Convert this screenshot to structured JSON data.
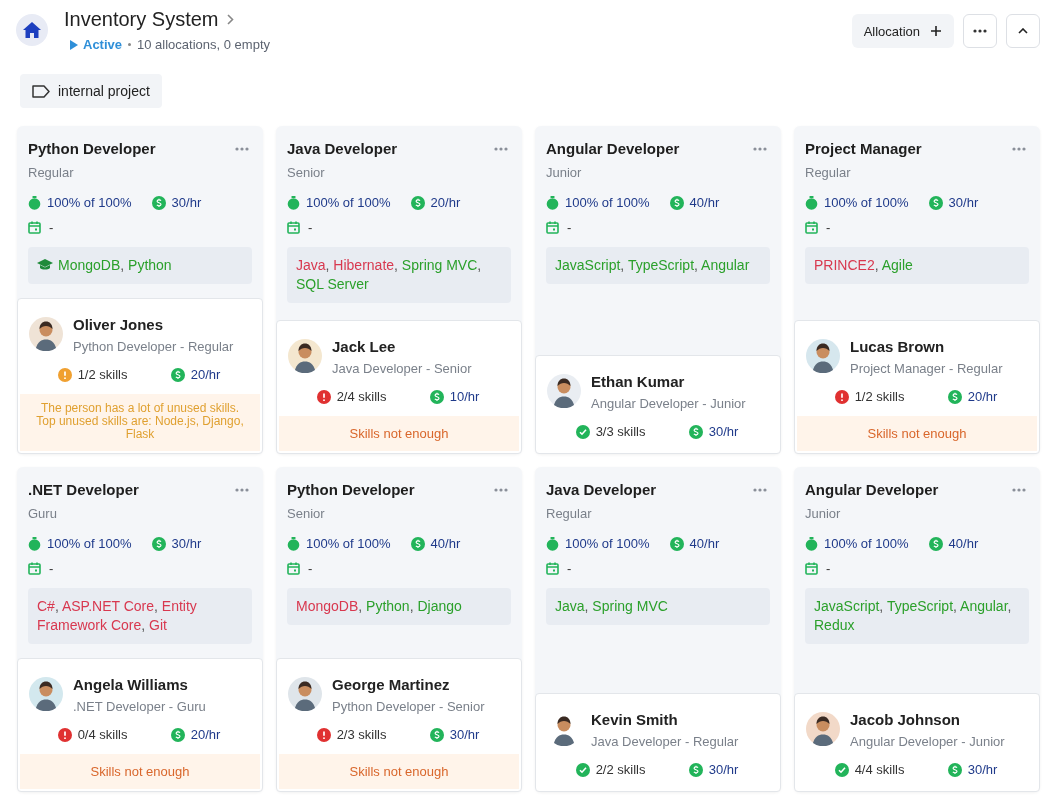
{
  "header": {
    "title": "Inventory System",
    "status": "Active",
    "summary": "10 allocations, 0 empty",
    "buttons": [
      {
        "kind": "add",
        "label": "Allocation"
      },
      {
        "kind": "more"
      },
      {
        "kind": "collapse"
      }
    ]
  },
  "tags": [
    {
      "label": "internal project"
    }
  ],
  "cards": [
    {
      "role": "Python Developer",
      "level": "Regular",
      "allocation": "100% of 100%",
      "rate": "30/hr",
      "date": "-",
      "skills_icon": true,
      "skills": [
        {
          "name": "MongoDB",
          "matched": true,
          "separator": ","
        },
        {
          "name": "Python",
          "matched": true
        }
      ],
      "person": {
        "name": "Oliver Jones",
        "subtitle": "Python Developer - Regular",
        "kind": "partial",
        "skills_count": "1/2 skills",
        "rate": "20/hr",
        "warning": {
          "kind": "unused",
          "text": "The person has a lot of unused skills. Top unused skills are: Node.js, Django, Flask"
        }
      }
    },
    {
      "role": "Java Developer",
      "level": "Senior",
      "allocation": "100% of 100%",
      "rate": "20/hr",
      "date": "-",
      "skills_icon": false,
      "skills": [
        {
          "name": "Java",
          "matched": false,
          "separator": ","
        },
        {
          "name": "Hibernate",
          "matched": false,
          "separator": ","
        },
        {
          "name": "Spring MVC",
          "matched": true,
          "separator": ","
        },
        {
          "name": "SQL Server",
          "matched": true
        }
      ],
      "person": {
        "name": "Jack Lee",
        "subtitle": "Java Developer - Senior",
        "kind": "missing",
        "skills_count": "2/4 skills",
        "rate": "10/hr",
        "warning": {
          "kind": "insufficient",
          "text": "Skills not enough"
        }
      }
    },
    {
      "role": "Angular Developer",
      "level": "Junior",
      "allocation": "100% of 100%",
      "rate": "40/hr",
      "date": "-",
      "skills_icon": false,
      "skills": [
        {
          "name": "JavaScript",
          "matched": true,
          "separator": ","
        },
        {
          "name": "TypeScript",
          "matched": true,
          "separator": ","
        },
        {
          "name": "Angular",
          "matched": true
        }
      ],
      "person": {
        "name": "Ethan Kumar",
        "subtitle": "Angular Developer - Junior",
        "kind": "complete",
        "skills_count": "3/3 skills",
        "rate": "30/hr"
      }
    },
    {
      "role": "Project Manager",
      "level": "Regular",
      "allocation": "100% of 100%",
      "rate": "30/hr",
      "date": "-",
      "skills_icon": false,
      "skills": [
        {
          "name": "PRINCE2",
          "matched": false,
          "separator": ","
        },
        {
          "name": "Agile",
          "matched": true
        }
      ],
      "person": {
        "name": "Lucas Brown",
        "subtitle": "Project Manager - Regular",
        "kind": "missing",
        "skills_count": "1/2 skills",
        "rate": "20/hr",
        "warning": {
          "kind": "insufficient",
          "text": "Skills not enough"
        }
      }
    },
    {
      "role": ".NET Developer",
      "level": "Guru",
      "allocation": "100% of 100%",
      "rate": "30/hr",
      "date": "-",
      "skills_icon": false,
      "skills": [
        {
          "name": "C#",
          "matched": false,
          "separator": ","
        },
        {
          "name": "ASP.NET Core",
          "matched": false,
          "separator": ","
        },
        {
          "name": "Entity Framework Core",
          "matched": false,
          "separator": ","
        },
        {
          "name": "Git",
          "matched": false
        }
      ],
      "person": {
        "name": "Angela Williams",
        "subtitle": ".NET Developer - Guru",
        "kind": "missing",
        "skills_count": "0/4 skills",
        "rate": "20/hr",
        "warning": {
          "kind": "insufficient",
          "text": "Skills not enough"
        }
      }
    },
    {
      "role": "Python Developer",
      "level": "Senior",
      "allocation": "100% of 100%",
      "rate": "40/hr",
      "date": "-",
      "skills_icon": false,
      "skills": [
        {
          "name": "MongoDB",
          "matched": false,
          "separator": ","
        },
        {
          "name": "Python",
          "matched": true,
          "separator": ","
        },
        {
          "name": "Django",
          "matched": true
        }
      ],
      "person": {
        "name": "George Martinez",
        "subtitle": "Python Developer - Senior",
        "kind": "missing",
        "skills_count": "2/3 skills",
        "rate": "30/hr",
        "warning": {
          "kind": "insufficient",
          "text": "Skills not enough"
        }
      }
    },
    {
      "role": "Java Developer",
      "level": "Regular",
      "allocation": "100% of 100%",
      "rate": "40/hr",
      "date": "-",
      "skills_icon": false,
      "skills": [
        {
          "name": "Java",
          "matched": true,
          "separator": ","
        },
        {
          "name": "Spring MVC",
          "matched": true
        }
      ],
      "person": {
        "name": "Kevin Smith",
        "subtitle": "Java Developer - Regular",
        "kind": "complete",
        "skills_count": "2/2 skills",
        "rate": "30/hr"
      }
    },
    {
      "role": "Angular Developer",
      "level": "Junior",
      "allocation": "100% of 100%",
      "rate": "40/hr",
      "date": "-",
      "skills_icon": false,
      "skills": [
        {
          "name": "JavaScript",
          "matched": true,
          "separator": ","
        },
        {
          "name": "TypeScript",
          "matched": true,
          "separator": ","
        },
        {
          "name": "Angular",
          "matched": true,
          "separator": ","
        },
        {
          "name": "Redux",
          "matched": true
        }
      ],
      "person": {
        "name": "Jacob Johnson",
        "subtitle": "Angular Developer - Junior",
        "kind": "complete",
        "skills_count": "4/4 skills",
        "rate": "30/hr"
      }
    }
  ]
}
